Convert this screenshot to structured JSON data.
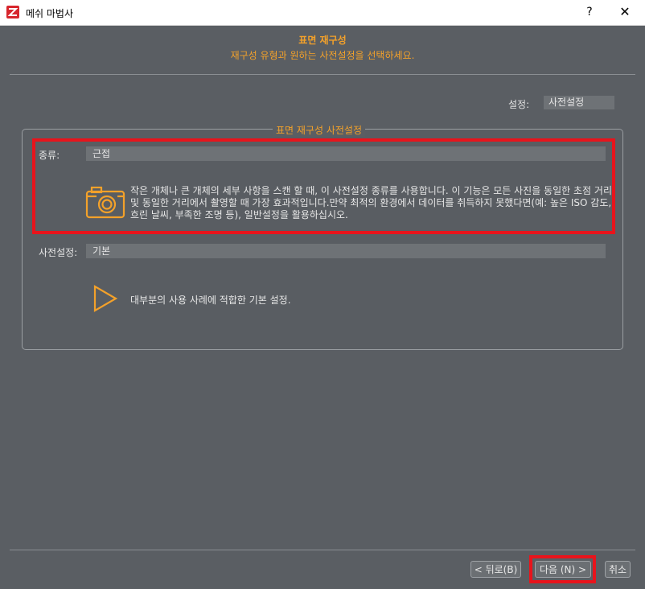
{
  "window": {
    "title": "메쉬 마법사",
    "help_label": "?",
    "close_label": "✕",
    "app_icon": "mesh-wizard-logo-icon"
  },
  "header": {
    "title": "표면 재구성",
    "subtitle": "재구성 유형과 원하는 사전설정을 선택하세요."
  },
  "settings": {
    "label": "설정:",
    "value": "사전설정"
  },
  "group": {
    "title": "표면 재구성 사전설정",
    "type_label": "종류:",
    "type_value": "근접",
    "type_icon": "camera-icon",
    "type_description": "작은 개체나 큰 개체의 세부 사항을 스캔 할 때, 이 사전설정 종류를 사용합니다. 이 기능은 모든 사진을 동일한 초점 거리 및 동일한 거리에서 촬영할 때 가장 효과적입니다.만약 최적의 환경에서 데이터를 취득하지 못했다면(예: 높은 ISO 감도, 흐린 날씨, 부족한 조명 등), 일반설정을 활용하십시오.",
    "preset_label": "사전설정:",
    "preset_value": "기본",
    "preset_icon": "play-triangle-icon",
    "preset_description": "대부분의 사용 사례에 적합한 기본 설정."
  },
  "footer": {
    "back_label": "< 뒤로(B)",
    "next_label": "다음 (N) >",
    "cancel_label": "취소"
  },
  "colors": {
    "accent": "#f3a12a",
    "background": "#5a5e63",
    "field": "#6e7276",
    "highlight": "#e8141c"
  }
}
